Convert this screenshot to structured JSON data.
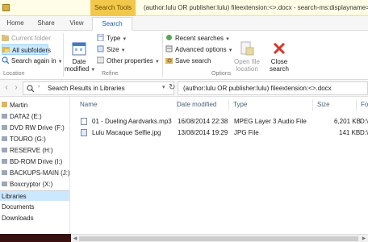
{
  "window": {
    "contextual_tab": "Search Tools",
    "title": "(author:lulu OR publisher:lulu) fileextension:<>.docx - search-ms:displayname=Se"
  },
  "tabs": [
    "Home",
    "Share",
    "View",
    "Search"
  ],
  "ribbon": {
    "location": {
      "label": "Location",
      "current_folder": "Current folder",
      "all_subfolders": "All subfolders",
      "search_again": "Search again in"
    },
    "refine": {
      "label": "Refine",
      "date_modified": "Date\nmodified",
      "type": "Type",
      "size": "Size",
      "other_properties": "Other properties"
    },
    "options": {
      "label": "Options",
      "recent_searches": "Recent searches",
      "advanced_options": "Advanced options",
      "save_search": "Save search",
      "open_file_location": "Open file\nlocation",
      "close_search": "Close\nsearch"
    }
  },
  "address": {
    "path": "Search Results in Libraries",
    "search_text": "(author:lulu OR publisher:lulu) fileextension:<>.docx"
  },
  "nav": {
    "items": [
      {
        "label": "Martin"
      },
      {
        "label": "DATA2 (E:)"
      },
      {
        "label": "DVD RW Drive (F:)"
      },
      {
        "label": "TOURO (G:)"
      },
      {
        "label": "RESERVE (H:)"
      },
      {
        "label": "BD-ROM Drive (I:)"
      },
      {
        "label": "BACKUPS-MAIN (J:)"
      },
      {
        "label": "Boxcryptor (X:)"
      },
      {
        "label": "Libraries"
      },
      {
        "label": "Documents"
      },
      {
        "label": "Downloads"
      }
    ]
  },
  "columns": [
    "Name",
    "Date modified",
    "Type",
    "Size",
    "Fo"
  ],
  "files": [
    {
      "name": "01 - Dueling Aardvarks.mp3",
      "date": "16/08/2014 22:38",
      "type": "MPEG Layer 3 Audio File",
      "size": "6,201 KB",
      "folder": "D:\\"
    },
    {
      "name": "Lulu Macaque Selfie.jpg",
      "date": "13/08/2014 19:29",
      "type": "JPG File",
      "size": "141 KB",
      "folder": "D:\\"
    }
  ],
  "colors": {
    "accent": "#1a5fa0",
    "context_tab": "#f2c84b",
    "selection": "#cce8ff"
  }
}
